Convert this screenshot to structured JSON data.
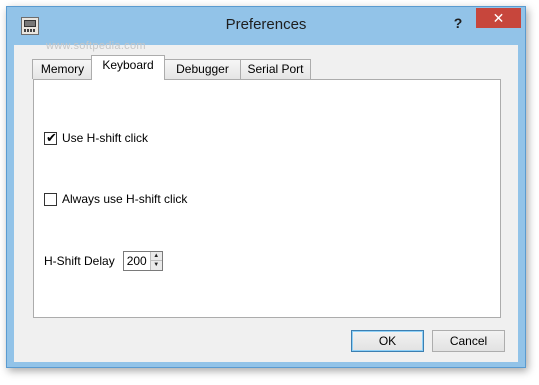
{
  "window": {
    "title": "Preferences",
    "help_label": "?",
    "close_label": "✕"
  },
  "tabs": [
    {
      "label": "Memory"
    },
    {
      "label": "Keyboard",
      "active": true
    },
    {
      "label": "Debugger"
    },
    {
      "label": "Serial Port"
    }
  ],
  "watermark": "www.softpedia.com",
  "keyboard": {
    "use_hshift_click": {
      "label": "Use H-shift click",
      "checked": true
    },
    "always_hshift_click": {
      "label": "Always use H-shift click",
      "checked": false
    },
    "hshift_delay": {
      "label": "H-Shift Delay",
      "value": "200"
    }
  },
  "buttons": {
    "ok": "OK",
    "cancel": "Cancel"
  }
}
